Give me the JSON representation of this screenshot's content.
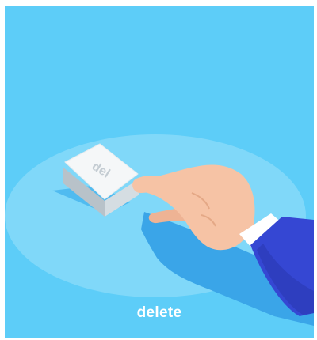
{
  "key": {
    "label": "del"
  },
  "caption": "delete",
  "colors": {
    "background": "#5dcdf8",
    "platform": "#80d8f9",
    "shadow": "#3aa5e8",
    "key_top": "#f5f7f8",
    "skin": "#f6c3a5",
    "sleeve": "#3547d3",
    "cuff": "#ffffff"
  }
}
